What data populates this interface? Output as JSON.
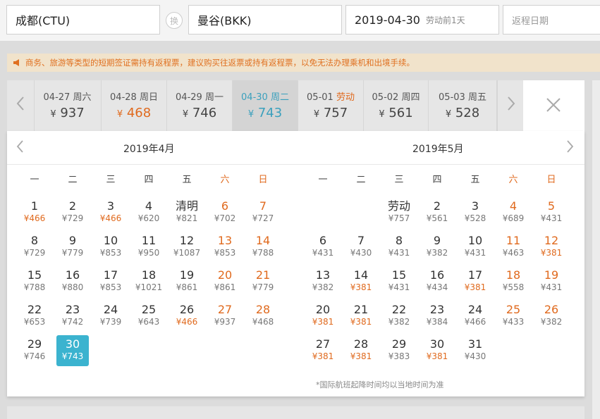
{
  "search": {
    "from": "成都(CTU)",
    "to": "曼谷(BKK)",
    "swap_label": "换",
    "depart_date": "2019-04-30",
    "depart_note": "劳动前1天",
    "return_placeholder": "返程日期"
  },
  "notice": {
    "text": "商务、旅游等类型的短期签证需持有返程票，建议购买往返票或持有返程票，以免无法办理乘机和出境手续。"
  },
  "strip": {
    "days": [
      {
        "date": "04-27",
        "weekday": "周六",
        "price": "937",
        "price_color": "#444444"
      },
      {
        "date": "04-28",
        "weekday": "周日",
        "price": "468",
        "price_color": "#e06a1e"
      },
      {
        "date": "04-29",
        "weekday": "周一",
        "price": "746",
        "price_color": "#444444"
      },
      {
        "date": "04-30",
        "weekday": "周二",
        "price": "743",
        "price_color": "#3aa0bd",
        "selected": true
      },
      {
        "date": "05-01",
        "weekday": "劳动",
        "price": "757",
        "price_color": "#444444",
        "holiday": true
      },
      {
        "date": "05-02",
        "weekday": "周四",
        "price": "561",
        "price_color": "#444444"
      },
      {
        "date": "05-03",
        "weekday": "周五",
        "price": "528",
        "price_color": "#444444"
      }
    ],
    "currency": "¥"
  },
  "calendar": {
    "weekdays": [
      "一",
      "二",
      "三",
      "四",
      "五",
      "六",
      "日"
    ],
    "months": [
      {
        "title": "2019年4月",
        "first_col": 0,
        "days": [
          {
            "n": "1",
            "p": "¥466",
            "lo": true
          },
          {
            "n": "2",
            "p": "¥729"
          },
          {
            "n": "3",
            "p": "¥466",
            "lo": true
          },
          {
            "n": "4",
            "p": "¥620"
          },
          {
            "n": "清明",
            "p": "¥821"
          },
          {
            "n": "6",
            "p": "¥702"
          },
          {
            "n": "7",
            "p": "¥727"
          },
          {
            "n": "8",
            "p": "¥729"
          },
          {
            "n": "9",
            "p": "¥779"
          },
          {
            "n": "10",
            "p": "¥853"
          },
          {
            "n": "11",
            "p": "¥950"
          },
          {
            "n": "12",
            "p": "¥1087"
          },
          {
            "n": "13",
            "p": "¥853"
          },
          {
            "n": "14",
            "p": "¥788"
          },
          {
            "n": "15",
            "p": "¥788"
          },
          {
            "n": "16",
            "p": "¥880"
          },
          {
            "n": "17",
            "p": "¥853"
          },
          {
            "n": "18",
            "p": "¥1021"
          },
          {
            "n": "19",
            "p": "¥861"
          },
          {
            "n": "20",
            "p": "¥861"
          },
          {
            "n": "21",
            "p": "¥779"
          },
          {
            "n": "22",
            "p": "¥653"
          },
          {
            "n": "23",
            "p": "¥742"
          },
          {
            "n": "24",
            "p": "¥739"
          },
          {
            "n": "25",
            "p": "¥643"
          },
          {
            "n": "26",
            "p": "¥466",
            "lo": true
          },
          {
            "n": "27",
            "p": "¥937"
          },
          {
            "n": "28",
            "p": "¥468"
          },
          {
            "n": "29",
            "p": "¥746"
          },
          {
            "n": "30",
            "p": "¥743",
            "sel": true
          }
        ]
      },
      {
        "title": "2019年5月",
        "first_col": 2,
        "days": [
          {
            "n": "劳动",
            "p": "¥757"
          },
          {
            "n": "2",
            "p": "¥561"
          },
          {
            "n": "3",
            "p": "¥528"
          },
          {
            "n": "4",
            "p": "¥689"
          },
          {
            "n": "5",
            "p": "¥431"
          },
          {
            "n": "6",
            "p": "¥431"
          },
          {
            "n": "7",
            "p": "¥430"
          },
          {
            "n": "8",
            "p": "¥431"
          },
          {
            "n": "9",
            "p": "¥382"
          },
          {
            "n": "10",
            "p": "¥431"
          },
          {
            "n": "11",
            "p": "¥463"
          },
          {
            "n": "12",
            "p": "¥381",
            "lo": true
          },
          {
            "n": "13",
            "p": "¥382"
          },
          {
            "n": "14",
            "p": "¥381",
            "lo": true
          },
          {
            "n": "15",
            "p": "¥431"
          },
          {
            "n": "16",
            "p": "¥434"
          },
          {
            "n": "17",
            "p": "¥381",
            "lo": true
          },
          {
            "n": "18",
            "p": "¥558"
          },
          {
            "n": "19",
            "p": "¥431"
          },
          {
            "n": "20",
            "p": "¥381",
            "lo": true
          },
          {
            "n": "21",
            "p": "¥381",
            "lo": true
          },
          {
            "n": "22",
            "p": "¥382"
          },
          {
            "n": "23",
            "p": "¥384"
          },
          {
            "n": "24",
            "p": "¥466"
          },
          {
            "n": "25",
            "p": "¥433"
          },
          {
            "n": "26",
            "p": "¥382"
          },
          {
            "n": "27",
            "p": "¥381",
            "lo": true
          },
          {
            "n": "28",
            "p": "¥381",
            "lo": true
          },
          {
            "n": "29",
            "p": "¥383"
          },
          {
            "n": "30",
            "p": "¥381",
            "lo": true
          },
          {
            "n": "31",
            "p": "¥430"
          }
        ]
      }
    ],
    "footnote": "*国际航班起降时间均以当地时间为准"
  },
  "colors": {
    "accent_blue": "#3bb3cf",
    "low_price_orange": "#e06a1e",
    "weekend_orange": "#e06a1e"
  },
  "icons": {
    "strip_prev": "chevron-left-icon",
    "strip_next": "chevron-right-icon",
    "close": "close-icon",
    "month_prev": "chevron-left-icon",
    "month_next": "chevron-right-icon",
    "notice": "megaphone-icon"
  }
}
